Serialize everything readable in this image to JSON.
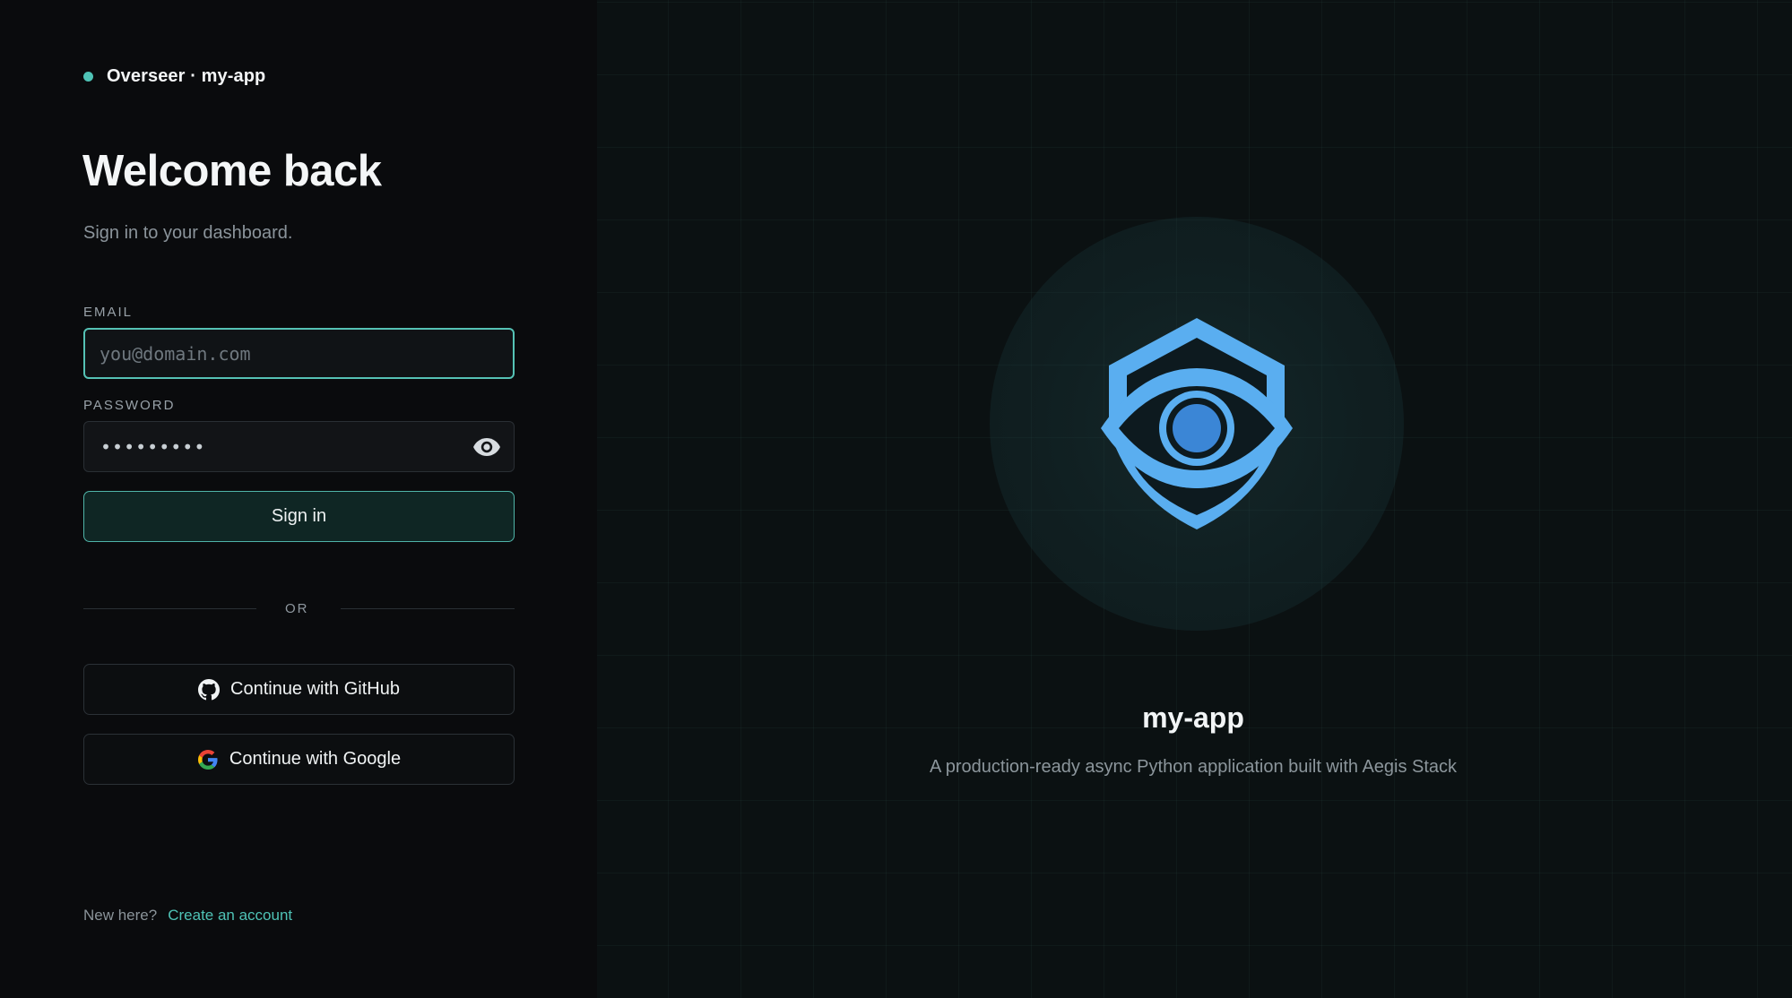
{
  "brand": {
    "name": "Overseer · my-app",
    "accent": "#4fc3b6"
  },
  "login": {
    "title": "Welcome back",
    "subtitle": "Sign in to your dashboard.",
    "email": {
      "label": "EMAIL",
      "placeholder": "you@domain.com",
      "value": ""
    },
    "password": {
      "label": "PASSWORD",
      "value": "•••••••••",
      "toggle_icon": "eye-icon"
    },
    "submit_label": "Sign in",
    "divider_label": "OR",
    "oauth": [
      {
        "label": "Continue with GitHub",
        "icon": "github-icon"
      },
      {
        "label": "Continue with Google",
        "icon": "google-icon"
      }
    ],
    "footer": {
      "prompt": "New here?",
      "link": "Create an account"
    }
  },
  "hero": {
    "logo_icon": "shield-eye-icon",
    "app_name": "my-app",
    "description": "A production-ready async Python application built with Aegis Stack",
    "logo_color": "#5aaef0"
  }
}
